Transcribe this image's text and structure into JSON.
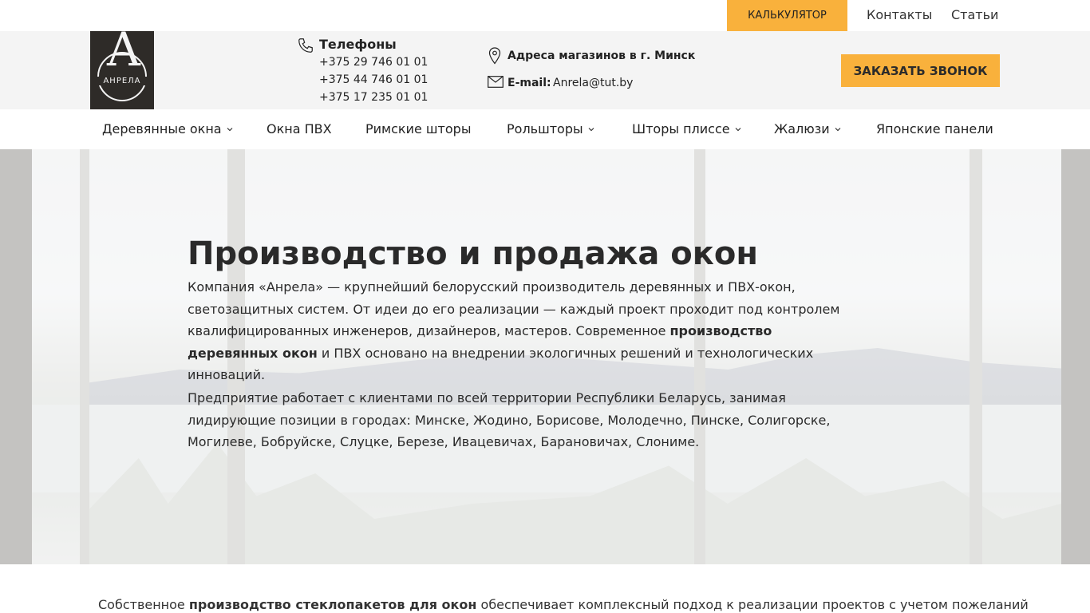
{
  "topbar": {
    "calculator_label": "Калькулятор",
    "contacts_label": "Контакты",
    "articles_label": "Статьи"
  },
  "logo": {
    "letter": "А",
    "name": "АНРЕЛА"
  },
  "header": {
    "phones_title": "Телефоны",
    "phones": [
      "+375 29 746 01 01",
      "+375 44 746 01 01",
      "+375 17 235 01 01"
    ],
    "address_label": "Адреса магазинов в г. Минск",
    "email_label": "E-mail:",
    "email_value": "Anrela@tut.by",
    "call_button_label": "Заказать звонок"
  },
  "nav": {
    "items": [
      {
        "label": "Деревянные окна",
        "has_dropdown": true
      },
      {
        "label": "Окна ПВХ",
        "has_dropdown": false
      },
      {
        "label": "Римские шторы",
        "has_dropdown": false
      },
      {
        "label": "Рольшторы",
        "has_dropdown": true
      },
      {
        "label": "Шторы плиссе",
        "has_dropdown": true
      },
      {
        "label": "Жалюзи",
        "has_dropdown": true
      },
      {
        "label": "Японские панели",
        "has_dropdown": false
      }
    ]
  },
  "hero": {
    "title": "Производство и продажа окон",
    "p1_part1": "Компания «Анрела» — крупнейший белорусский производитель деревянных и ПВХ-окон, светозащитных систем. От идеи до его реализации — каждый проект проходит под контролем квалифицированных инженеров, дизайнеров, мастеров. Современное ",
    "p1_bold": "производство деревянных окон",
    "p1_part2": " и ПВХ основано на внедрении экологичных решений и технологических инноваций.",
    "p2": "Предприятие работает с клиентами по всей территории Республики Беларусь, занимая лидирующие позиции в городах: Минске, Жодино, Борисове, Молодечно, Пинске, Солигорске, Могилеве, Бобруйске, Слуцке, Березе, Ивацевичах, Барановичах, Слониме."
  },
  "bottom": {
    "part1": "Собственное ",
    "bold": "производство стеклопакетов для окон",
    "part2": " обеспечивает комплексный подход к реализации проектов с учетом пожеланий"
  },
  "colors": {
    "accent": "#f9b13c",
    "header_bg": "#f4f4f4",
    "logo_bg": "#2e2b28"
  }
}
